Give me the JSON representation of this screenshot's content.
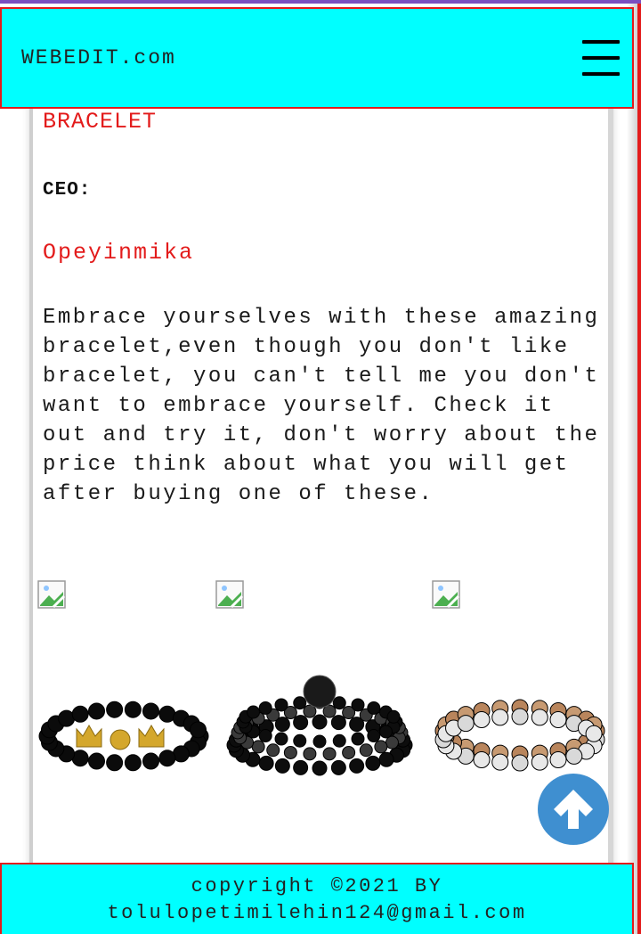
{
  "header": {
    "logo": "WEBEDIT.com",
    "menu_icon": "hamburger-menu-icon"
  },
  "product": {
    "title": "BRACELET",
    "ceo_label": "CEO:",
    "ceo_name": "Opeyinmika",
    "description": "Embrace yourselves with these amazing bracelet,even though you don't like bracelet, you can't tell me you don't want to embrace yourself. Check it out and try it, don't worry about the price think about what you will get after buying one of these."
  },
  "gallery": {
    "broken_images": [
      "broken-image-icon",
      "broken-image-icon",
      "broken-image-icon"
    ],
    "bracelets": [
      {
        "name": "black-bead-gold-crown-bracelet",
        "colors": [
          "#0b0b0b",
          "#d4a72c"
        ]
      },
      {
        "name": "black-lion-bracelet-set",
        "colors": [
          "#0d0d0d",
          "#3a3a3a"
        ]
      },
      {
        "name": "white-brown-stone-bracelet-set",
        "colors": [
          "#c79a72",
          "#e8e8e8"
        ]
      }
    ]
  },
  "footer": {
    "line1": "copyright ©2021 BY",
    "line2": "tolulopetimilehin124@gmail.com"
  },
  "scroll_top": {
    "icon": "arrow-up-icon",
    "color": "#3f8fd0"
  },
  "colors": {
    "header_bg": "#00ffff",
    "accent_red": "#e31b1b",
    "top_border": "#7a4fc0"
  }
}
